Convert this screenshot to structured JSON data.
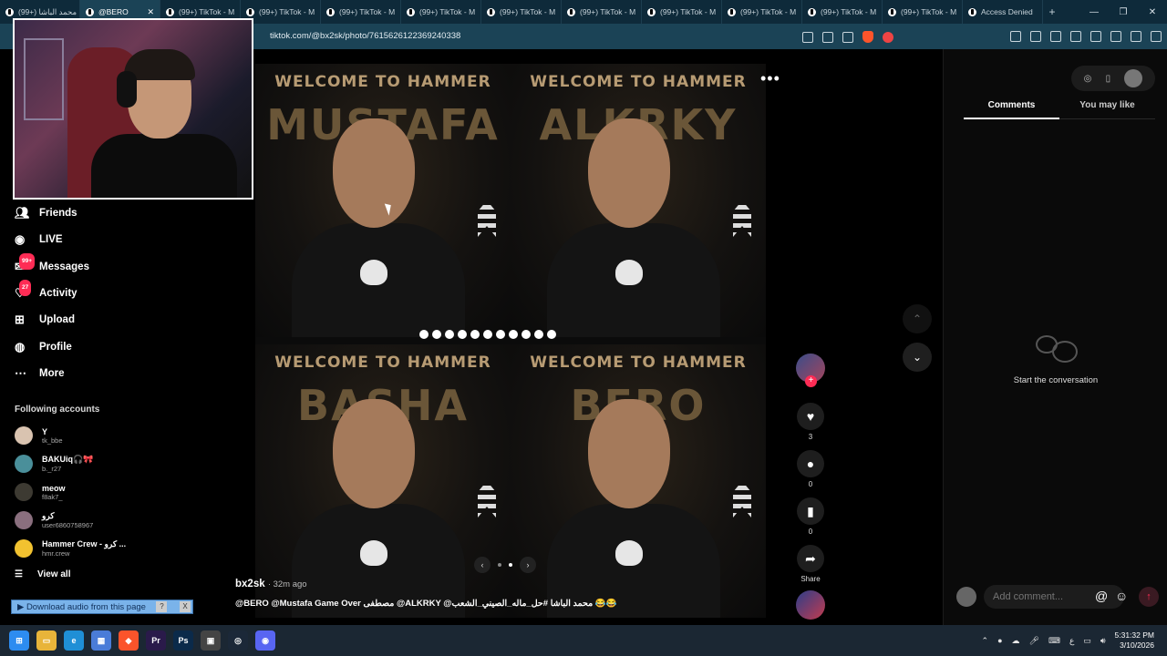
{
  "browser": {
    "tabs": [
      {
        "label": "(99+) محمد الباشا"
      },
      {
        "label": "@BERO",
        "active": true
      },
      {
        "label": "(99+) TikTok - M"
      },
      {
        "label": "(99+) TikTok - M"
      },
      {
        "label": "(99+) TikTok - M"
      },
      {
        "label": "(99+) TikTok - M"
      },
      {
        "label": "(99+) TikTok - M"
      },
      {
        "label": "(99+) TikTok - M"
      },
      {
        "label": "(99+) TikTok - M"
      },
      {
        "label": "(99+) TikTok - M"
      },
      {
        "label": "(99+) TikTok - M"
      },
      {
        "label": "(99+) TikTok - M"
      },
      {
        "label": "Access Denied"
      }
    ],
    "url": "tiktok.com/@bx2sk/photo/7615626122369240338",
    "brave_badge": "1"
  },
  "sidebar": {
    "nav": [
      {
        "label": "Friends",
        "icon": "friends-icon"
      },
      {
        "label": "LIVE",
        "icon": "live-icon"
      },
      {
        "label": "Messages",
        "icon": "messages-icon",
        "badge": "99+"
      },
      {
        "label": "Activity",
        "icon": "activity-icon",
        "badge": "27"
      },
      {
        "label": "Upload",
        "icon": "upload-icon"
      },
      {
        "label": "Profile",
        "icon": "profile-icon"
      },
      {
        "label": "More",
        "icon": "more-icon"
      }
    ],
    "following_title": "Following accounts",
    "following": [
      {
        "name": "Y",
        "handle": "tk_bbe",
        "color": "#d9c3b0"
      },
      {
        "name": "BAKUiq🎧🎀",
        "handle": "b._r27",
        "color": "#4a8f9a"
      },
      {
        "name": "meow",
        "handle": "f8ak7_",
        "color": "#3d3a32"
      },
      {
        "name": "كرو",
        "handle": "user6860758967",
        "color": "#8a6f7e"
      },
      {
        "name": "Hammer Crew - كرو ...",
        "handle": "hmr.crew",
        "color": "#f2c230"
      }
    ],
    "view_all": "View all"
  },
  "photo": {
    "panels": [
      {
        "welcome": "WELCOME TO HAMMER",
        "name": "MUSTAFA"
      },
      {
        "welcome": "WELCOME TO HAMMER",
        "name": "ALKRKY"
      },
      {
        "welcome": "WELCOME TO HAMMER",
        "name": "BASHA"
      },
      {
        "welcome": "WELCOME TO HAMMER",
        "name": "BERO"
      }
    ],
    "dot_count": 11,
    "author": "bx2sk",
    "time_ago": "· 32m ago",
    "caption": "@BERO @Mustafa Game Over مصطفى @ALKRKY @محمد الباشا #حل_ماله_الصيني_الشعب 😂😂"
  },
  "actions": {
    "likes": "3",
    "comments": "0",
    "saves": "0",
    "share": "Share"
  },
  "right_panel": {
    "tabs": [
      "Comments",
      "You may like"
    ],
    "empty_text": "Start the conversation",
    "comment_placeholder": "Add comment..."
  },
  "download_bar": {
    "label": "▶ Download audio from this page",
    "help": "?",
    "close": "X"
  },
  "taskbar": {
    "apps": [
      {
        "name": "windows-start-icon",
        "color": "#2d8cf0",
        "glyph": "⊞"
      },
      {
        "name": "file-explorer-icon",
        "color": "#e8b43a",
        "glyph": "▭"
      },
      {
        "name": "edge-icon",
        "color": "#1f8fd6",
        "glyph": "e"
      },
      {
        "name": "store-icon",
        "color": "#4a7cd8",
        "glyph": "▦"
      },
      {
        "name": "brave-icon",
        "color": "#fb542b",
        "glyph": "◆"
      },
      {
        "name": "premiere-icon",
        "color": "#2a1a4a",
        "glyph": "Pr"
      },
      {
        "name": "photoshop-icon",
        "color": "#0b2a4a",
        "glyph": "Ps"
      },
      {
        "name": "capcut-icon",
        "color": "#444",
        "glyph": "▣"
      },
      {
        "name": "steam-icon",
        "color": "#1b2838",
        "glyph": "◎"
      },
      {
        "name": "discord-icon",
        "color": "#5865f2",
        "glyph": "◉"
      }
    ],
    "time": "5:31:32 PM",
    "date": "3/10/2026",
    "lang": "ع"
  }
}
